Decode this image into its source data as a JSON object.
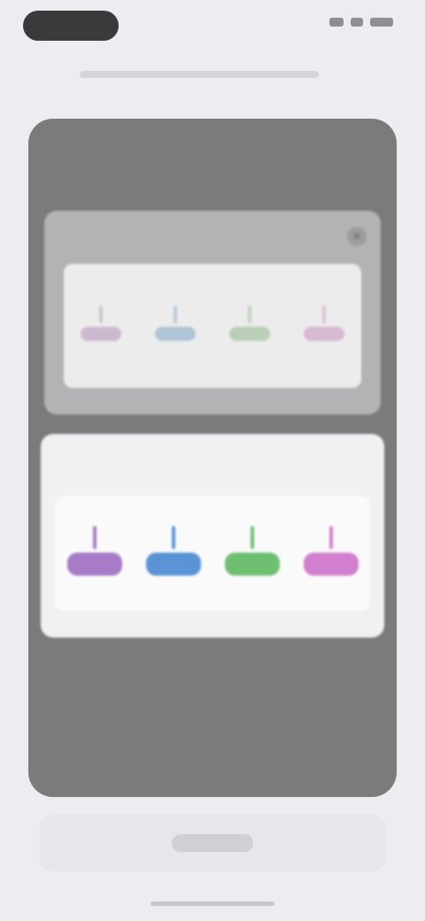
{
  "status_bar": {
    "indicator_icons": [
      "signal-icon",
      "wifi-icon",
      "battery-icon"
    ]
  },
  "sheet": {
    "title": ""
  },
  "card_back": {
    "header": "",
    "close_icon": "close-icon",
    "swatches": [
      {
        "color": "#b58fb8",
        "label": ""
      },
      {
        "color": "#7fa4c9",
        "label": ""
      },
      {
        "color": "#8fb88a",
        "label": ""
      },
      {
        "color": "#c98fbd",
        "label": ""
      }
    ]
  },
  "card_front": {
    "header": "",
    "swatches": [
      {
        "color": "#a77bc8",
        "label": ""
      },
      {
        "color": "#5b94d6",
        "label": ""
      },
      {
        "color": "#6fbf72",
        "label": ""
      },
      {
        "color": "#d27fcf",
        "label": ""
      }
    ]
  },
  "bottom": {
    "button_label": ""
  }
}
